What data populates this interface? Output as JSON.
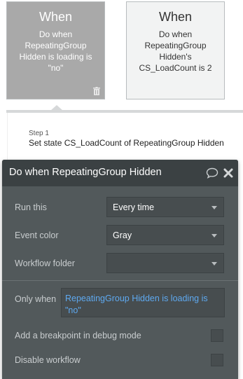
{
  "cards": [
    {
      "title": "When",
      "text": "Do when RepeatingGroup Hidden is loading is \"no\""
    },
    {
      "title": "When",
      "text": "Do when RepeatingGroup Hidden's CS_LoadCount is 2"
    }
  ],
  "step": {
    "label": "Step 1",
    "text": "Set state CS_LoadCount of RepeatingGroup Hidden"
  },
  "panel": {
    "title": "Do when RepeatingGroup Hidden is loading is \"no\"",
    "fields": {
      "run_this": {
        "label": "Run this",
        "value": "Every time"
      },
      "event_color": {
        "label": "Event color",
        "value": "Gray"
      },
      "workflow_folder": {
        "label": "Workflow folder",
        "value": ""
      }
    },
    "only_when": {
      "label": "Only when",
      "value": "RepeatingGroup Hidden is loading is \"no\""
    },
    "breakpoint": {
      "label": "Add a breakpoint in debug mode",
      "checked": false
    },
    "disable": {
      "label": "Disable workflow",
      "checked": false
    }
  },
  "colors": {
    "selected_card": "#a9a9a9",
    "panel_bg": "#52595b",
    "panel_header": "#3b4143",
    "condition_link": "#5ea9f0"
  },
  "icons": [
    "trash-icon",
    "comment-icon",
    "close-icon",
    "chevron-down-icon"
  ]
}
